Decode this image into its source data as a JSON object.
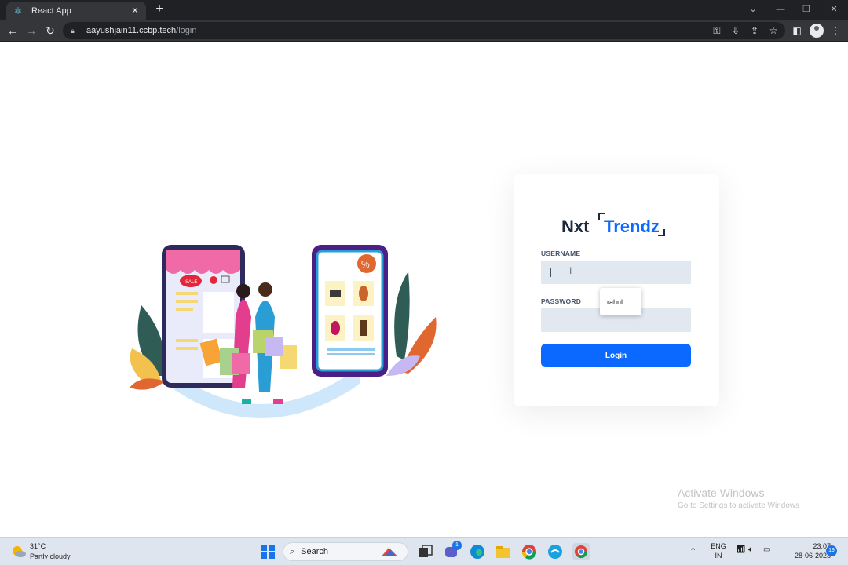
{
  "browser": {
    "tab_title": "React App",
    "tab_close": "✕",
    "new_tab": "+",
    "url_host": "aayushjain11.ccbp.tech",
    "url_path": "/login"
  },
  "login": {
    "brand_part1": "Nxt",
    "brand_part2": "Trendz",
    "username_label": "USERNAME",
    "username_value": "",
    "password_label": "PASSWORD",
    "password_value": "",
    "button_label": "Login",
    "autofill_suggestion": "rahul"
  },
  "watermark": {
    "title": "Activate Windows",
    "subtitle": "Go to Settings to activate Windows"
  },
  "taskbar": {
    "weather_temp": "31°C",
    "weather_desc": "Partly cloudy",
    "search_label": "Search",
    "teams_badge": "1",
    "lang_top": "ENG",
    "lang_bottom": "IN",
    "time": "23:07",
    "date": "28-06-2023",
    "notification_count": "19"
  },
  "colors": {
    "primary": "#0b69ff",
    "brand_dark": "#1e293b",
    "input_bg": "#e2e8f0"
  }
}
